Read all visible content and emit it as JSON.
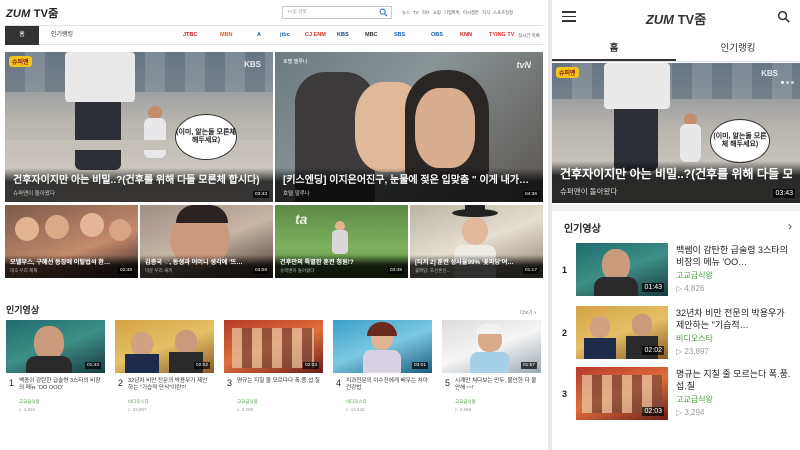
{
  "brand": {
    "logo_main": "ZUM",
    "logo_sub": "TV줌"
  },
  "desktop": {
    "search_placeholder": "TV줌 검색",
    "util_links": [
      "뉴스",
      "TV",
      "허브",
      "쇼핑",
      "기업톡톡",
      "이시청한",
      "지식",
      "스포츠일정"
    ],
    "tabs": {
      "home": "홈",
      "ranking": "인기랭킹"
    },
    "channels": [
      {
        "name": "JTBC",
        "color": "#c4161c"
      },
      {
        "name": "MBN",
        "color": "#e85a20"
      },
      {
        "name": "A",
        "color": "#2255aa"
      },
      {
        "name": "jtbc",
        "color": "#1d6aa8"
      },
      {
        "name": "CJ ENM",
        "color": "#d0312d"
      },
      {
        "name": "KBS",
        "color": "#1a3b8a"
      },
      {
        "name": "MBC",
        "color": "#333333"
      },
      {
        "name": "SBS",
        "color": "#1a5db3"
      },
      {
        "name": "OBS",
        "color": "#0f5aa8"
      },
      {
        "name": "KNN",
        "color": "#c4161c"
      },
      {
        "name": "TYING TV",
        "color": "#e2332c"
      }
    ],
    "channels_more": "실시간 목록",
    "hero_left": {
      "title": "건후자이지만 아는 비밀..?(건후를 위해 다들 모른체 합시다)",
      "source": "슈퍼맨이 돌아왔다",
      "duration": "03:43",
      "bubble": "(이미, 알는둘 모른체 해두세요)",
      "watermark": "KBS"
    },
    "hero_right": {
      "title": "[키스엔딩] 이지은어진구, 눈물에 젖은 입맞춤 \" 이게 내가…",
      "source": "호텔 델루나",
      "duration": "04:36",
      "watermark": "tvN"
    },
    "small": [
      {
        "title": "모델부스, 구혜선 등장에 이탈법석 환…",
        "source": "대호 우리 제제",
        "duration": "02:48"
      },
      {
        "title": "김종국 ♡, 동생과 어머니 생각에 '뜨…",
        "source": "미운 우리 새끼",
        "duration": "03:08"
      },
      {
        "title": "건후만의 특별한 훈련 첨원!?",
        "source": "슈퍼맨이 돌아왔다",
        "duration": "03:49"
      },
      {
        "title": "[티저 2] 훈련 성사율99% '꽃파당'여…",
        "source": "꽃파당: 조선혼인…",
        "duration": "01:17"
      }
    ],
    "popular_title": "인기영상",
    "popular_more": "더보기 >",
    "popular": [
      {
        "num": "1",
        "title": "백종이 감탄한 급술령 3스타의 비장의 메뉴 'OO OOO'",
        "channel": "고교급식왕",
        "views": "▷ 4,819",
        "duration": "01:43"
      },
      {
        "num": "2",
        "title": "32년차 비만 전문의 박용우가 제안하는 \"기습적 단식\"이란?!",
        "channel": "비디오스타",
        "views": "▷ 23,897",
        "duration": "02:02"
      },
      {
        "num": "3",
        "title": "명규는 지칠 줄 모르다다 폭.풍.섭.칠",
        "channel": "고교급식왕",
        "views": "▷ 3,289",
        "duration": "02:03"
      },
      {
        "num": "4",
        "title": "치과전문의 이수진에게 배우는 치아 건강법",
        "channel": "비디오스타",
        "views": "▷ 14,532",
        "duration": "03:01"
      },
      {
        "num": "5",
        "title": "시계만 쳐다보는 만두, 불안한 다 불안해~~!",
        "channel": "고교급식왕",
        "views": "▷ 3,569",
        "duration": "01:57"
      }
    ]
  },
  "mobile": {
    "tabs": {
      "home": "홈",
      "ranking": "인기랭킹"
    },
    "hero": {
      "title": "건후자이지만 아는 비밀..?(건후를 위해 다들 모",
      "source": "슈퍼맨이 돌아왔다",
      "duration": "03:43",
      "bubble": "(이미, 알는둘 모른체 해두세요)",
      "watermark": "KBS"
    },
    "popular_title": "인기영상",
    "popular": [
      {
        "num": "1",
        "title": "백쌤이 감탄한 급술령 3스타의 비장의 메뉴 'OO…",
        "channel": "고교급식왕",
        "views": "▷ 4,826",
        "duration": "01:43"
      },
      {
        "num": "2",
        "title": "32년차 비만 전문의 박용우가 제안하는 \"기습적…",
        "channel": "비디오스타",
        "views": "▷ 23,897",
        "duration": "02:02"
      },
      {
        "num": "3",
        "title": "명규는 지칠 줄 모르는다 폭.풍.섭.칠",
        "channel": "고교급식왕",
        "views": "▷ 3,294",
        "duration": "02:03"
      }
    ]
  },
  "colors": {
    "accent_green": "#4a9a3e",
    "search_blue": "#2a6fd6"
  }
}
